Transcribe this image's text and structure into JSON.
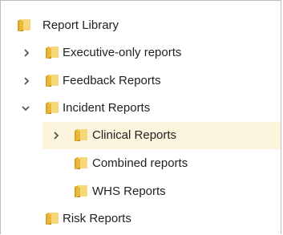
{
  "tree": {
    "root": {
      "label": "Report Library"
    },
    "executive": {
      "label": "Executive-only reports",
      "expanded": false
    },
    "feedback": {
      "label": "Feedback Reports",
      "expanded": false
    },
    "incident": {
      "label": "Incident Reports",
      "expanded": true
    },
    "clinical": {
      "label": "Clinical Reports",
      "expanded": false,
      "selected": true
    },
    "combined": {
      "label": "Combined reports"
    },
    "whs": {
      "label": "WHS Reports"
    },
    "risk": {
      "label": "Risk Reports"
    }
  },
  "icons": {
    "folder": "folder-icon",
    "collapsed": "chevron-right-icon",
    "expanded": "chevron-down-icon"
  },
  "colors": {
    "folder_light": "#f6d77a",
    "folder_dark": "#d7a321",
    "folder_shadow": "#b8861a",
    "selected_row": "#fcf4dc",
    "chevron": "#555555"
  }
}
